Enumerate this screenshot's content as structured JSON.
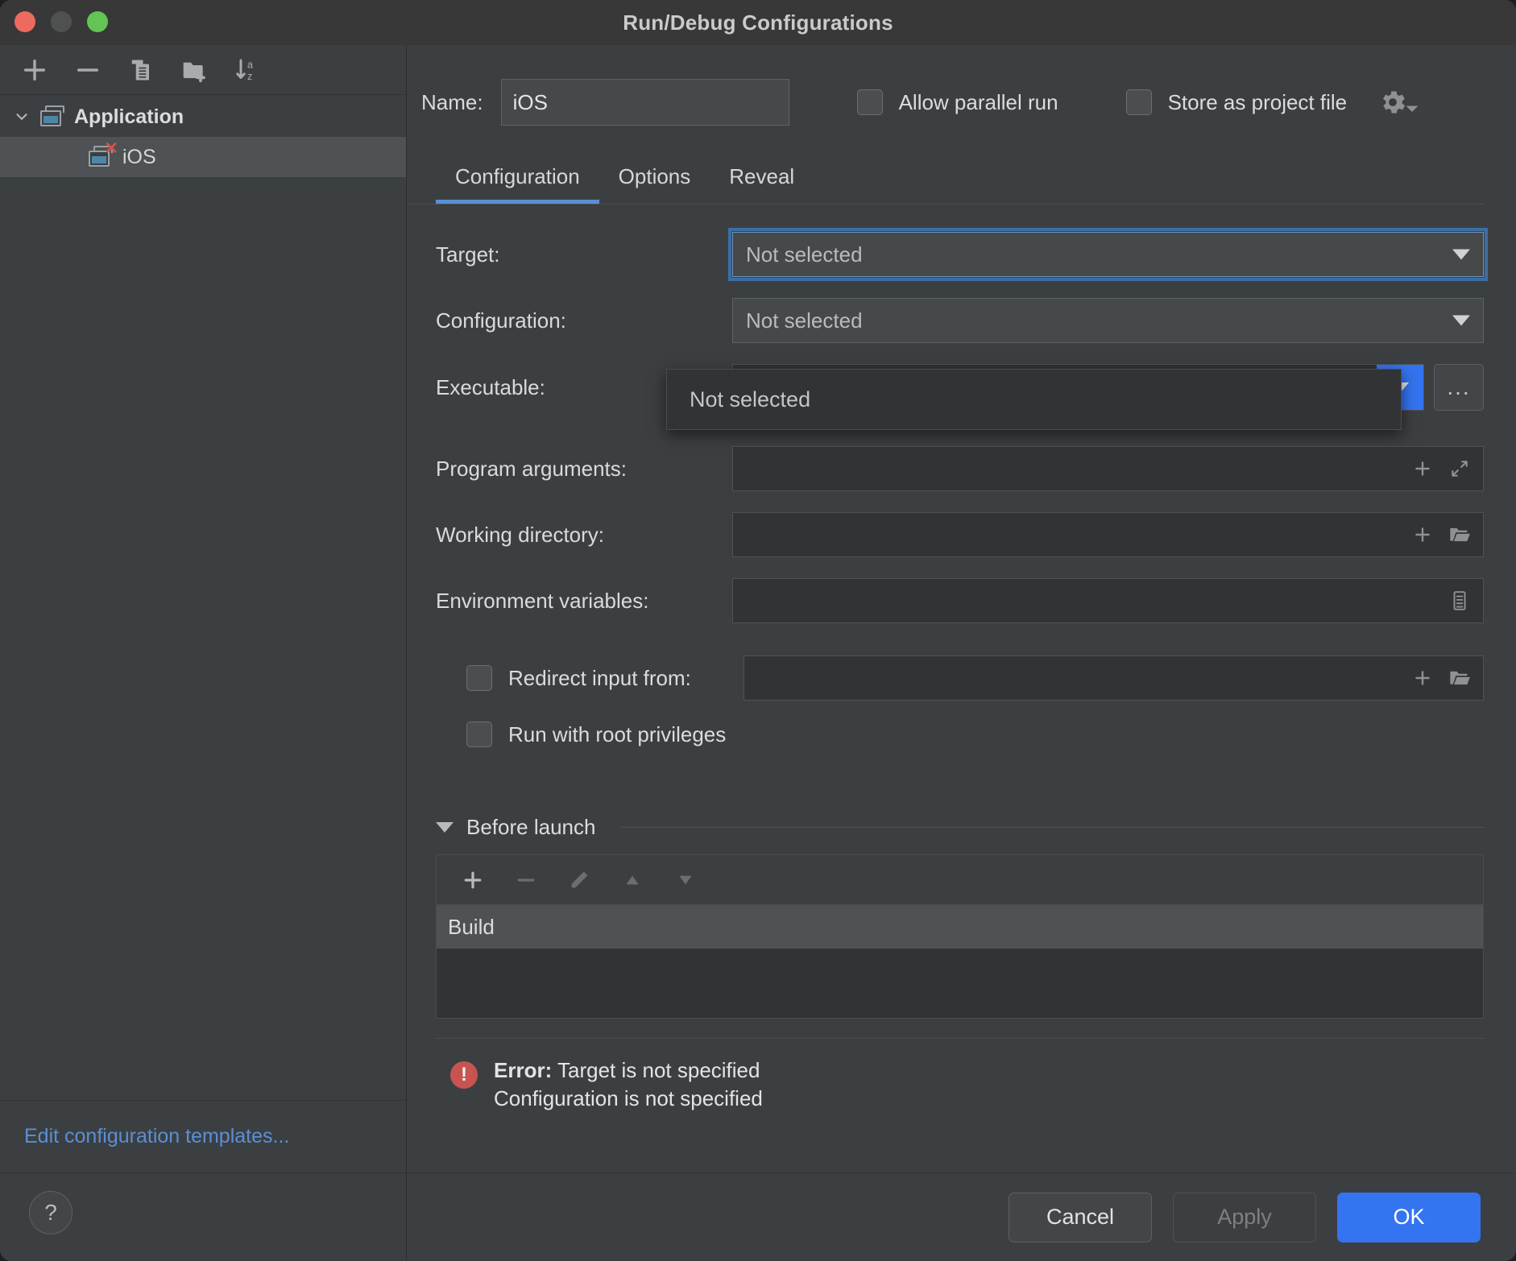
{
  "window": {
    "title": "Run/Debug Configurations",
    "traffic_lights": [
      "close",
      "minimize",
      "zoom"
    ]
  },
  "sidebar": {
    "toolbar": [
      {
        "name": "add",
        "icon": "plus-icon"
      },
      {
        "name": "remove",
        "icon": "minus-icon"
      },
      {
        "name": "copy",
        "icon": "copy-icon"
      },
      {
        "name": "new-folder",
        "icon": "folder-add-icon"
      },
      {
        "name": "sort",
        "icon": "sort-alphabetical-icon"
      }
    ],
    "tree": [
      {
        "label": "Application",
        "type": "group",
        "expanded": true,
        "selected": false
      },
      {
        "label": "iOS",
        "type": "item",
        "selected": true,
        "has_error": true
      }
    ],
    "edit_templates_link": "Edit configuration templates...",
    "help_label": "?"
  },
  "form": {
    "name_label": "Name:",
    "name_value": "iOS",
    "allow_parallel_run": {
      "label": "Allow parallel run",
      "checked": false
    },
    "store_as_project_file": {
      "label": "Store as project file",
      "checked": false
    },
    "gear_icon": "gear-icon"
  },
  "tabs": [
    {
      "label": "Configuration",
      "active": true
    },
    {
      "label": "Options",
      "active": false
    },
    {
      "label": "Reveal",
      "active": false
    }
  ],
  "fields": {
    "target": {
      "label": "Target:",
      "value": "Not selected",
      "focused": true
    },
    "configuration": {
      "label": "Configuration:",
      "value": "Not selected"
    },
    "executable": {
      "label": "Executable:",
      "value": "Not selected",
      "browse_label": "..."
    },
    "program_arguments": {
      "label": "Program arguments:",
      "value": "",
      "icons": [
        "plus-icon",
        "expand-icon"
      ]
    },
    "working_directory": {
      "label": "Working directory:",
      "value": "",
      "icons": [
        "plus-icon",
        "folder-icon"
      ]
    },
    "environment_variables": {
      "label": "Environment variables:",
      "value": "",
      "icons": [
        "list-icon"
      ]
    },
    "redirect_input_from": {
      "label": "Redirect input from:",
      "checked": false,
      "value": "",
      "icons": [
        "plus-icon",
        "folder-icon"
      ]
    },
    "run_with_root_privileges": {
      "label": "Run with root privileges",
      "checked": false
    }
  },
  "target_popup": {
    "open": true,
    "items": [
      "Not selected"
    ]
  },
  "before_launch": {
    "title": "Before launch",
    "expanded": true,
    "toolbar": [
      {
        "name": "add",
        "icon": "plus-icon",
        "enabled": true
      },
      {
        "name": "remove",
        "icon": "minus-icon",
        "enabled": false
      },
      {
        "name": "edit",
        "icon": "pencil-icon",
        "enabled": false
      },
      {
        "name": "move-up",
        "icon": "arrow-up-icon",
        "enabled": false
      },
      {
        "name": "move-down",
        "icon": "arrow-down-icon",
        "enabled": false
      }
    ],
    "items": [
      {
        "label": "Build",
        "selected": true
      }
    ]
  },
  "error": {
    "icon": "error-icon",
    "prefix": "Error:",
    "line1": " Target is not specified",
    "line2": "Configuration is not specified"
  },
  "footer": {
    "cancel": "Cancel",
    "apply": "Apply",
    "ok": "OK"
  },
  "colors": {
    "accent_blue": "#3574f0",
    "tab_underline": "#5a8fd6",
    "link_blue": "#5a8fd6",
    "error_red": "#c75450",
    "window_bg": "#3c3f41",
    "field_bg": "#313335"
  }
}
